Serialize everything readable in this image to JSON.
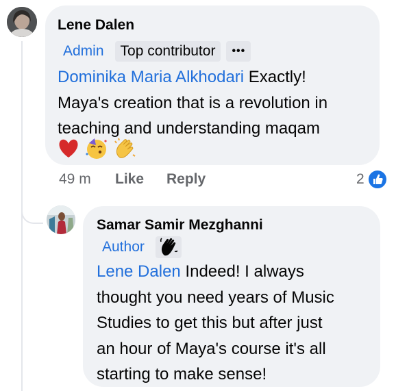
{
  "comment": {
    "author": "Lene Dalen",
    "badges": [
      "Admin",
      "Top contributor"
    ],
    "badge_more": "•••",
    "mention": "Dominika Maria Alkhodari",
    "text_lines": [
      " Exactly!",
      "Maya's creation that is a revolution in",
      "teaching and understanding maqam"
    ],
    "emojis": [
      "heart",
      "partying-face",
      "clapping-hands"
    ],
    "time": "49 m",
    "like_label": "Like",
    "reply_label": "Reply",
    "reaction_count": "2",
    "reaction_type": "like"
  },
  "reply": {
    "author": "Samar Samir Mezghanni",
    "badge": "Author",
    "badge_icon": "waving-hand",
    "mention": "Lene Dalen",
    "text_lines": [
      " Indeed! I always",
      "thought you need years of Music",
      "Studies to get this but after just",
      "an hour of Maya's course it's all",
      "starting to make sense!"
    ]
  },
  "colors": {
    "bubble": "#f0f2f5",
    "mention": "#216fdb",
    "muted": "#65676b",
    "like_blue": "#1b74e4",
    "thread_line": "#e4e6eb"
  }
}
